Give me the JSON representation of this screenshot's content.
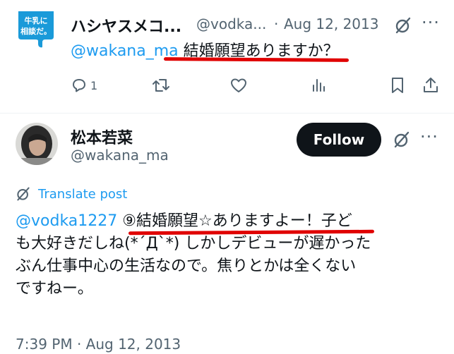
{
  "reply": {
    "avatar_text_line1": "牛乳に",
    "avatar_text_line2": "相談だ。",
    "name": "ハシヤスメコ...",
    "handle": "@vodka...",
    "separator": "·",
    "date": "Aug 12, 2013",
    "mention": "@wakana_ma",
    "text": " 結婚願望ありますか？",
    "reply_count": "1",
    "more": "···"
  },
  "main": {
    "name": "松本若菜",
    "handle": "@wakana_ma",
    "follow_label": "Follow",
    "more": "···",
    "translate_label": "Translate post",
    "mention": "@vodka1227",
    "line1_rest": " ⑨結婚願望☆ありますよー！子ど",
    "line2": "も大好きだしね(*´Д`*) しかしデビューが遅かった",
    "line3": "ぶん仕事中心の生活なので。焦りとかは全くない",
    "line4": "ですねー。",
    "timestamp": "7:39 PM · Aug 12, 2013"
  },
  "colors": {
    "accent_blue": "#1d9bf0",
    "text_primary": "#0f1419",
    "text_secondary": "#536471",
    "highlight_red": "#e00000",
    "avatar_blue": "#1a9ad9"
  },
  "icons": {
    "reply": "reply-icon",
    "retweet": "retweet-icon",
    "like": "heart-icon",
    "views": "views-icon",
    "bookmark": "bookmark-icon",
    "share": "share-icon",
    "grok": "grok-icon",
    "more": "more-icon",
    "translate": "translate-icon"
  }
}
